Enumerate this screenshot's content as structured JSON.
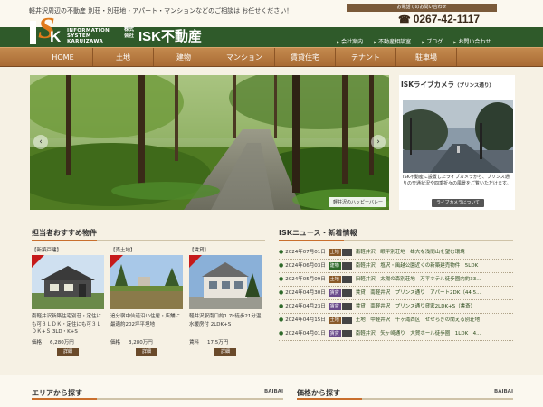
{
  "header": {
    "tagline": "軽井沢周辺の不動産 別荘・別荘地・アパート・マンションなどのご相談は お任せください！",
    "contact_label": "お電話でのお問い合わせ",
    "phone": "0267-42-1117",
    "logo": {
      "mark_s": "S",
      "mark_k": "K",
      "sub_lines": [
        "INFORMATION",
        "SYSTEM",
        "KARUIZAWA"
      ],
      "corp": "株式会社",
      "name": "ISK不動産"
    },
    "util_nav": [
      "会社案内",
      "不動産相談室",
      "ブログ",
      "お問い合わせ"
    ]
  },
  "main_nav": [
    "HOME",
    "土地",
    "建物",
    "マンション",
    "賃貸住宅",
    "テナント",
    "駐車場"
  ],
  "hero": {
    "caption": "軽井沢のハッピーバレー",
    "prev_label": "‹",
    "next_label": "›"
  },
  "livecam": {
    "title": "ISKライブカメラ",
    "subtitle": "（プリンス通り）",
    "description": "ISK不動産に設置したライブカメラから、プリンス通りの交通状況や四季折々の風景をご覧いただけます。",
    "button": "ライブカメラについて"
  },
  "recommend": {
    "title": "担当者おすすめ物件",
    "button_label": "詳細",
    "items": [
      {
        "tag": "【新築戸建】",
        "description": "南軽井沢新築住宅別荘・定住にも可３ＬＤＫ・定住にも可３ＬＤＫ+Ｓ 3LD・K+S",
        "price_label": "価格",
        "price": "6,280万円"
      },
      {
        "tag": "【売土地】",
        "description": "追分宿中仙道沿い住居・店舗に最適約202坪平坦地",
        "price_label": "価格",
        "price": "3,280万円"
      },
      {
        "tag": "【賃貸】",
        "description": "軽井沢駅南口約1.7k徒歩21分温水暖房付 2LDK+S",
        "price_label": "賃料",
        "price": "17.5万円"
      }
    ]
  },
  "news": {
    "title": "ISKニュース・新着情報",
    "items": [
      {
        "date": "2024年07月01日",
        "badge": "土地",
        "badge_color": "#8a5a2a",
        "text": "南軽井沢　眼平別荘地　雄大な浅間山を望む環境"
      },
      {
        "date": "2024年06月03日",
        "badge": "建物",
        "badge_color": "#2f6a2a",
        "text": "南軽井沢　塩沢・風越公園近くの新築建売物件　5LDK"
      },
      {
        "date": "2024年05月09日",
        "badge": "土地",
        "badge_color": "#8a5a2a",
        "text": "旧軽井沢　太陽の森別荘地　万平ホテル徒歩圏内約33..."
      },
      {
        "date": "2024年04月30日",
        "badge": "賃貸",
        "badge_color": "#6a4a8a",
        "text": "賃貸　南軽井沢　プリンス通り　アパート2DK（44.5..."
      },
      {
        "date": "2024年04月23日",
        "badge": "賃貸",
        "badge_color": "#6a4a8a",
        "text": "賃貸　南軽井沢　プリンス通り貸家2LDK+S（書斎）"
      },
      {
        "date": "2024年04月15日",
        "badge": "土地",
        "badge_color": "#8a5a2a",
        "text": "土地　中軽井沢　千ヶ滝西区　せせらぎの聞える別荘地"
      },
      {
        "date": "2024年04月01日",
        "badge": "賃貸",
        "badge_color": "#6a4a8a",
        "text": "南軽井沢　矢ヶ崎通り　大賀ホール徒歩圏　1LDK　4..."
      }
    ]
  },
  "search_sections": [
    {
      "title": "エリアから探す",
      "brand": "BAIBAI"
    },
    {
      "title": "価格から探す",
      "brand": "BAIBAI"
    }
  ]
}
